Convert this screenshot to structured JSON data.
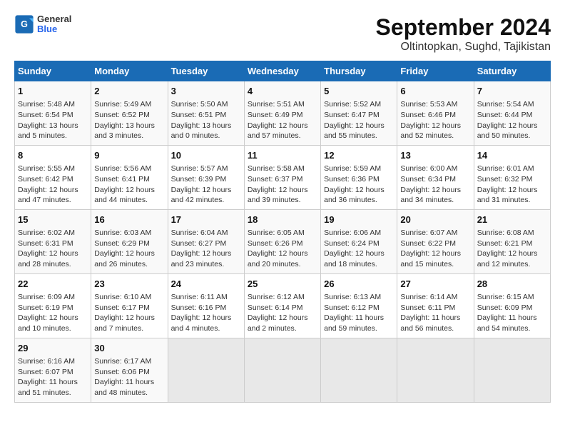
{
  "header": {
    "logo_general": "General",
    "logo_blue": "Blue",
    "title": "September 2024",
    "subtitle": "Oltintopkan, Sughd, Tajikistan"
  },
  "calendar": {
    "days_of_week": [
      "Sunday",
      "Monday",
      "Tuesday",
      "Wednesday",
      "Thursday",
      "Friday",
      "Saturday"
    ],
    "weeks": [
      [
        {
          "day": "1",
          "sunrise": "5:48 AM",
          "sunset": "6:54 PM",
          "daylight": "13 hours and 5 minutes."
        },
        {
          "day": "2",
          "sunrise": "5:49 AM",
          "sunset": "6:52 PM",
          "daylight": "13 hours and 3 minutes."
        },
        {
          "day": "3",
          "sunrise": "5:50 AM",
          "sunset": "6:51 PM",
          "daylight": "13 hours and 0 minutes."
        },
        {
          "day": "4",
          "sunrise": "5:51 AM",
          "sunset": "6:49 PM",
          "daylight": "12 hours and 57 minutes."
        },
        {
          "day": "5",
          "sunrise": "5:52 AM",
          "sunset": "6:47 PM",
          "daylight": "12 hours and 55 minutes."
        },
        {
          "day": "6",
          "sunrise": "5:53 AM",
          "sunset": "6:46 PM",
          "daylight": "12 hours and 52 minutes."
        },
        {
          "day": "7",
          "sunrise": "5:54 AM",
          "sunset": "6:44 PM",
          "daylight": "12 hours and 50 minutes."
        }
      ],
      [
        {
          "day": "8",
          "sunrise": "5:55 AM",
          "sunset": "6:42 PM",
          "daylight": "12 hours and 47 minutes."
        },
        {
          "day": "9",
          "sunrise": "5:56 AM",
          "sunset": "6:41 PM",
          "daylight": "12 hours and 44 minutes."
        },
        {
          "day": "10",
          "sunrise": "5:57 AM",
          "sunset": "6:39 PM",
          "daylight": "12 hours and 42 minutes."
        },
        {
          "day": "11",
          "sunrise": "5:58 AM",
          "sunset": "6:37 PM",
          "daylight": "12 hours and 39 minutes."
        },
        {
          "day": "12",
          "sunrise": "5:59 AM",
          "sunset": "6:36 PM",
          "daylight": "12 hours and 36 minutes."
        },
        {
          "day": "13",
          "sunrise": "6:00 AM",
          "sunset": "6:34 PM",
          "daylight": "12 hours and 34 minutes."
        },
        {
          "day": "14",
          "sunrise": "6:01 AM",
          "sunset": "6:32 PM",
          "daylight": "12 hours and 31 minutes."
        }
      ],
      [
        {
          "day": "15",
          "sunrise": "6:02 AM",
          "sunset": "6:31 PM",
          "daylight": "12 hours and 28 minutes."
        },
        {
          "day": "16",
          "sunrise": "6:03 AM",
          "sunset": "6:29 PM",
          "daylight": "12 hours and 26 minutes."
        },
        {
          "day": "17",
          "sunrise": "6:04 AM",
          "sunset": "6:27 PM",
          "daylight": "12 hours and 23 minutes."
        },
        {
          "day": "18",
          "sunrise": "6:05 AM",
          "sunset": "6:26 PM",
          "daylight": "12 hours and 20 minutes."
        },
        {
          "day": "19",
          "sunrise": "6:06 AM",
          "sunset": "6:24 PM",
          "daylight": "12 hours and 18 minutes."
        },
        {
          "day": "20",
          "sunrise": "6:07 AM",
          "sunset": "6:22 PM",
          "daylight": "12 hours and 15 minutes."
        },
        {
          "day": "21",
          "sunrise": "6:08 AM",
          "sunset": "6:21 PM",
          "daylight": "12 hours and 12 minutes."
        }
      ],
      [
        {
          "day": "22",
          "sunrise": "6:09 AM",
          "sunset": "6:19 PM",
          "daylight": "12 hours and 10 minutes."
        },
        {
          "day": "23",
          "sunrise": "6:10 AM",
          "sunset": "6:17 PM",
          "daylight": "12 hours and 7 minutes."
        },
        {
          "day": "24",
          "sunrise": "6:11 AM",
          "sunset": "6:16 PM",
          "daylight": "12 hours and 4 minutes."
        },
        {
          "day": "25",
          "sunrise": "6:12 AM",
          "sunset": "6:14 PM",
          "daylight": "12 hours and 2 minutes."
        },
        {
          "day": "26",
          "sunrise": "6:13 AM",
          "sunset": "6:12 PM",
          "daylight": "11 hours and 59 minutes."
        },
        {
          "day": "27",
          "sunrise": "6:14 AM",
          "sunset": "6:11 PM",
          "daylight": "11 hours and 56 minutes."
        },
        {
          "day": "28",
          "sunrise": "6:15 AM",
          "sunset": "6:09 PM",
          "daylight": "11 hours and 54 minutes."
        }
      ],
      [
        {
          "day": "29",
          "sunrise": "6:16 AM",
          "sunset": "6:07 PM",
          "daylight": "11 hours and 51 minutes."
        },
        {
          "day": "30",
          "sunrise": "6:17 AM",
          "sunset": "6:06 PM",
          "daylight": "11 hours and 48 minutes."
        },
        null,
        null,
        null,
        null,
        null
      ]
    ]
  }
}
